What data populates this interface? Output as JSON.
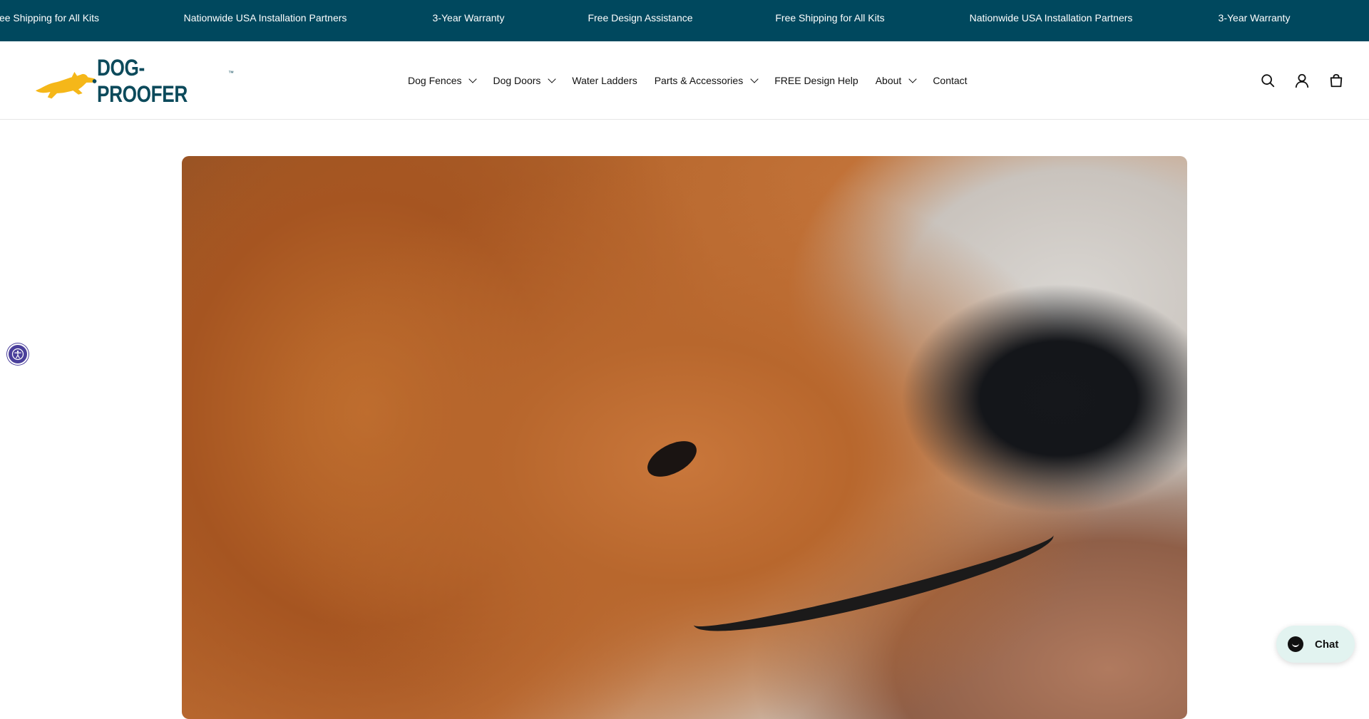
{
  "announcement": {
    "items": [
      "ee Shipping for All Kits",
      "Nationwide USA Installation Partners",
      "3-Year Warranty",
      "Free Design Assistance",
      "Free Shipping for All Kits",
      "Nationwide USA Installation Partners",
      "3-Year Warranty"
    ]
  },
  "logo": {
    "text": "DOG-PROOFER",
    "trademark": "™"
  },
  "nav": {
    "items": [
      {
        "label": "Dog Fences",
        "dropdown": true
      },
      {
        "label": "Dog Doors",
        "dropdown": true
      },
      {
        "label": "Water Ladders",
        "dropdown": false
      },
      {
        "label": "Parts & Accessories",
        "dropdown": true
      },
      {
        "label": "FREE Design Help",
        "dropdown": false
      },
      {
        "label": "About",
        "dropdown": true
      },
      {
        "label": "Contact",
        "dropdown": false
      }
    ]
  },
  "header_icons": [
    "search-icon",
    "account-icon",
    "cart-icon"
  ],
  "chat": {
    "label": "Chat"
  },
  "colors": {
    "announcement_bg": "#00485e",
    "logo_navy": "#0c4a5b",
    "logo_yellow": "#f5b719",
    "accessibility_bg": "#4a3f9b",
    "chat_bg": "#e2f3f0"
  }
}
